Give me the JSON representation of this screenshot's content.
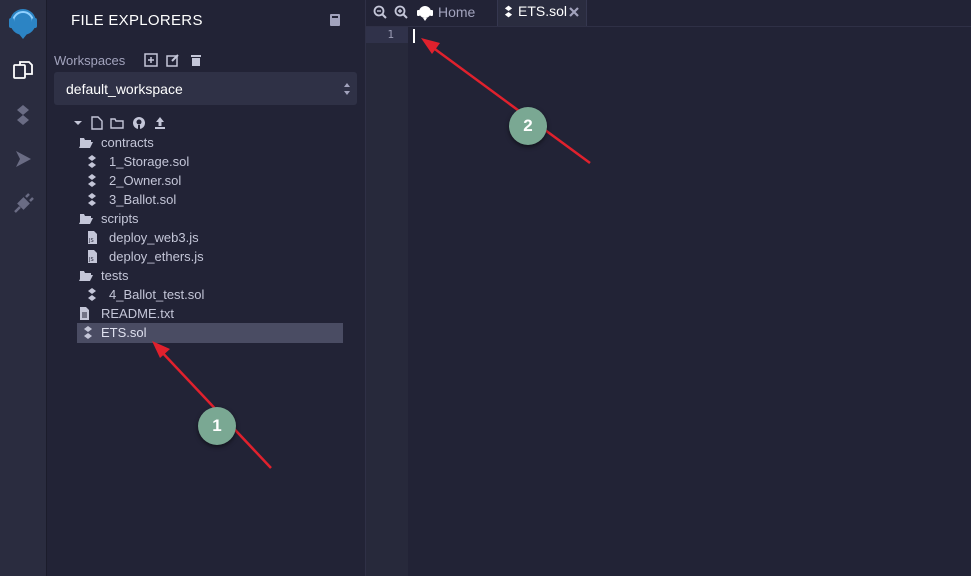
{
  "sidebar_rail": {
    "items": [
      {
        "icon": "remix-logo-icon"
      },
      {
        "icon": "file-explorer-icon",
        "active": true
      },
      {
        "icon": "solidity-compiler-icon"
      },
      {
        "icon": "deploy-run-icon"
      },
      {
        "icon": "plugin-manager-icon"
      }
    ]
  },
  "explorer": {
    "title": "FILE EXPLORERS",
    "workspaces_label": "Workspaces",
    "workspace_selected": "default_workspace",
    "tree": [
      {
        "label": "contracts",
        "type": "folder"
      },
      {
        "label": "1_Storage.sol",
        "type": "sol"
      },
      {
        "label": "2_Owner.sol",
        "type": "sol"
      },
      {
        "label": "3_Ballot.sol",
        "type": "sol"
      },
      {
        "label": "scripts",
        "type": "folder"
      },
      {
        "label": "deploy_web3.js",
        "type": "js"
      },
      {
        "label": "deploy_ethers.js",
        "type": "js"
      },
      {
        "label": "tests",
        "type": "folder"
      },
      {
        "label": "4_Ballot_test.sol",
        "type": "sol"
      },
      {
        "label": "README.txt",
        "type": "txt"
      },
      {
        "label": "ETS.sol",
        "type": "sol",
        "selected": true
      }
    ]
  },
  "editor": {
    "tabs": [
      {
        "label": "Home"
      },
      {
        "label": "ETS.sol",
        "active": true
      }
    ],
    "line_numbers": [
      "1"
    ]
  },
  "annotations": {
    "badge_1": "1",
    "badge_2": "2"
  },
  "colors": {
    "accent_arrow": "#e0212d",
    "badge": "#7aa893",
    "selected_row": "#4a4c63"
  }
}
